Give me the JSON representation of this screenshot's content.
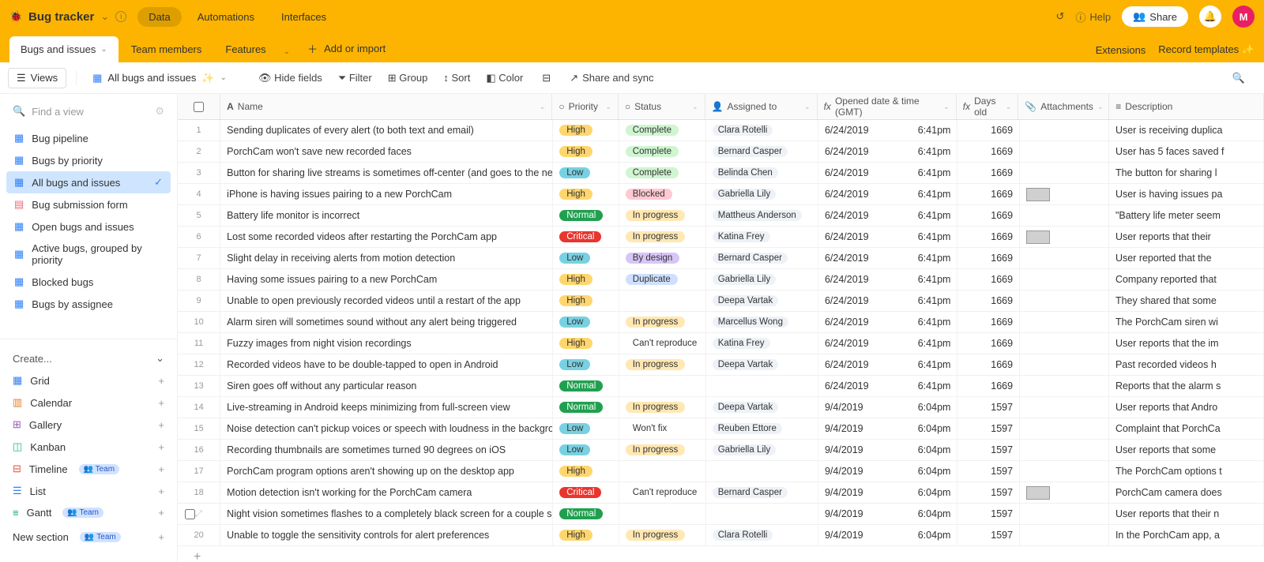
{
  "header": {
    "baseName": "Bug tracker",
    "tabs": [
      "Data",
      "Automations",
      "Interfaces"
    ],
    "activeTab": 0,
    "help": "Help",
    "share": "Share",
    "avatar": "M"
  },
  "tableTabs": {
    "tabs": [
      "Bugs and issues",
      "Team members",
      "Features"
    ],
    "activeTab": 0,
    "addLabel": "Add or import",
    "rightLinks": [
      "Extensions",
      "Record templates"
    ]
  },
  "toolbar": {
    "views": "Views",
    "currentView": "All bugs and issues",
    "items": [
      "Hide fields",
      "Filter",
      "Group",
      "Sort",
      "Color"
    ],
    "shareSync": "Share and sync"
  },
  "sidebar": {
    "searchPlaceholder": "Find a view",
    "views": [
      {
        "icon": "grid",
        "label": "Bug pipeline"
      },
      {
        "icon": "grid",
        "label": "Bugs by priority"
      },
      {
        "icon": "grid",
        "label": "All bugs and issues",
        "active": true
      },
      {
        "icon": "form",
        "label": "Bug submission form"
      },
      {
        "icon": "grid",
        "label": "Open bugs and issues"
      },
      {
        "icon": "grid",
        "label": "Active bugs, grouped by priority"
      },
      {
        "icon": "grid",
        "label": "Blocked bugs"
      },
      {
        "icon": "grid",
        "label": "Bugs by assignee"
      }
    ],
    "createLabel": "Create...",
    "createItems": [
      {
        "icon": "grid",
        "label": "Grid",
        "color": "#2d7ff9"
      },
      {
        "icon": "calendar",
        "label": "Calendar",
        "color": "#e67e22"
      },
      {
        "icon": "gallery",
        "label": "Gallery",
        "color": "#9b59b6"
      },
      {
        "icon": "kanban",
        "label": "Kanban",
        "color": "#1abc9c"
      },
      {
        "icon": "timeline",
        "label": "Timeline",
        "color": "#e74c3c",
        "badge": "Team"
      },
      {
        "icon": "list",
        "label": "List",
        "color": "#2d7ff9"
      },
      {
        "icon": "gantt",
        "label": "Gantt",
        "color": "#16a085",
        "badge": "Team"
      }
    ],
    "newSection": {
      "label": "New section",
      "badge": "Team"
    }
  },
  "columns": [
    {
      "key": "name",
      "label": "Name",
      "icon": "A"
    },
    {
      "key": "priority",
      "label": "Priority",
      "icon": "○"
    },
    {
      "key": "status",
      "label": "Status",
      "icon": "○"
    },
    {
      "key": "assigned",
      "label": "Assigned to",
      "icon": "👤"
    },
    {
      "key": "opened",
      "label": "Opened date & time (GMT)",
      "icon": "fx"
    },
    {
      "key": "days",
      "label": "Days old",
      "icon": "fx"
    },
    {
      "key": "attachments",
      "label": "Attachments",
      "icon": "📎"
    },
    {
      "key": "description",
      "label": "Description",
      "icon": "≡"
    }
  ],
  "rows": [
    {
      "n": 1,
      "name": "Sending duplicates of every alert (to both text and email)",
      "priority": "High",
      "status": "Complete",
      "assigned": "Clara Rotelli",
      "date": "6/24/2019",
      "time": "6:41pm",
      "days": 1669,
      "desc": "User is receiving duplica"
    },
    {
      "n": 2,
      "name": "PorchCam won't save new recorded faces",
      "priority": "High",
      "status": "Complete",
      "assigned": "Bernard Casper",
      "date": "6/24/2019",
      "time": "6:41pm",
      "days": 1669,
      "desc": "User has 5 faces saved f"
    },
    {
      "n": 3,
      "name": "Button for sharing live streams is sometimes off-center (and goes to the next row)",
      "priority": "Low",
      "status": "Complete",
      "assigned": "Belinda Chen",
      "date": "6/24/2019",
      "time": "6:41pm",
      "days": 1669,
      "desc": "The button for sharing l"
    },
    {
      "n": 4,
      "name": "iPhone is having issues pairing to a new PorchCam",
      "priority": "High",
      "status": "Blocked",
      "assigned": "Gabriella Lily",
      "date": "6/24/2019",
      "time": "6:41pm",
      "days": 1669,
      "att": true,
      "desc": "User is having issues pa"
    },
    {
      "n": 5,
      "name": "Battery life monitor is incorrect",
      "priority": "Normal",
      "status": "In progress",
      "assigned": "Mattheus Anderson",
      "date": "6/24/2019",
      "time": "6:41pm",
      "days": 1669,
      "desc": "\"Battery life meter seem"
    },
    {
      "n": 6,
      "name": "Lost some recorded videos after restarting the PorchCam app",
      "priority": "Critical",
      "status": "In progress",
      "assigned": "Katina Frey",
      "date": "6/24/2019",
      "time": "6:41pm",
      "days": 1669,
      "att": true,
      "desc": "User reports that their"
    },
    {
      "n": 7,
      "name": "Slight delay in receiving alerts from motion detection",
      "priority": "Low",
      "status": "By design",
      "assigned": "Bernard Casper",
      "date": "6/24/2019",
      "time": "6:41pm",
      "days": 1669,
      "desc": "User reported that the"
    },
    {
      "n": 8,
      "name": "Having some issues pairing to a new PorchCam",
      "priority": "High",
      "status": "Duplicate",
      "assigned": "Gabriella Lily",
      "date": "6/24/2019",
      "time": "6:41pm",
      "days": 1669,
      "desc": "Company reported that"
    },
    {
      "n": 9,
      "name": "Unable to open previously recorded videos until a restart of the app",
      "priority": "High",
      "status": "",
      "assigned": "Deepa Vartak",
      "date": "6/24/2019",
      "time": "6:41pm",
      "days": 1669,
      "desc": "They shared that some"
    },
    {
      "n": 10,
      "name": "Alarm siren will sometimes sound without any alert being triggered",
      "priority": "Low",
      "status": "In progress",
      "assigned": "Marcellus Wong",
      "date": "6/24/2019",
      "time": "6:41pm",
      "days": 1669,
      "desc": "The PorchCam siren wi"
    },
    {
      "n": 11,
      "name": "Fuzzy images from night vision recordings",
      "priority": "High",
      "status": "Can't reproduce",
      "assigned": "Katina Frey",
      "date": "6/24/2019",
      "time": "6:41pm",
      "days": 1669,
      "desc": "User reports that the im"
    },
    {
      "n": 12,
      "name": "Recorded videos have to be double-tapped to open in Android",
      "priority": "Low",
      "status": "In progress",
      "assigned": "Deepa Vartak",
      "date": "6/24/2019",
      "time": "6:41pm",
      "days": 1669,
      "desc": "Past recorded videos h"
    },
    {
      "n": 13,
      "name": "Siren goes off without any particular reason",
      "priority": "Normal",
      "status": "",
      "assigned": "",
      "date": "6/24/2019",
      "time": "6:41pm",
      "days": 1669,
      "desc": "Reports that the alarm s"
    },
    {
      "n": 14,
      "name": "Live-streaming in Android keeps minimizing from full-screen view",
      "priority": "Normal",
      "status": "In progress",
      "assigned": "Deepa Vartak",
      "date": "9/4/2019",
      "time": "6:04pm",
      "days": 1597,
      "desc": "User reports that Andro"
    },
    {
      "n": 15,
      "name": "Noise detection can't pickup voices or speech with loudness in the background",
      "priority": "Low",
      "status": "Won't fix",
      "assigned": "Reuben Ettore",
      "date": "9/4/2019",
      "time": "6:04pm",
      "days": 1597,
      "desc": "Complaint that PorchCa"
    },
    {
      "n": 16,
      "name": "Recording thumbnails are sometimes turned 90 degrees on iOS",
      "priority": "Low",
      "status": "In progress",
      "assigned": "Gabriella Lily",
      "date": "9/4/2019",
      "time": "6:04pm",
      "days": 1597,
      "desc": "User reports that some"
    },
    {
      "n": 17,
      "name": "PorchCam program options aren't showing up on the desktop app",
      "priority": "High",
      "status": "",
      "assigned": "",
      "date": "9/4/2019",
      "time": "6:04pm",
      "days": 1597,
      "desc": "The PorchCam options t"
    },
    {
      "n": 18,
      "name": "Motion detection isn't working for the PorchCam camera",
      "priority": "Critical",
      "status": "Can't reproduce",
      "assigned": "Bernard Casper",
      "date": "9/4/2019",
      "time": "6:04pm",
      "days": 1597,
      "att": true,
      "desc": "PorchCam camera does"
    },
    {
      "n": 19,
      "name": "Night vision sometimes flashes to a completely black screen for a couple seconds",
      "priority": "Normal",
      "status": "",
      "assigned": "",
      "date": "9/4/2019",
      "time": "6:04pm",
      "days": 1597,
      "expand": true,
      "desc": "User reports that their n"
    },
    {
      "n": 20,
      "name": "Unable to toggle the sensitivity controls for alert preferences",
      "priority": "High",
      "status": "In progress",
      "assigned": "Clara Rotelli",
      "date": "9/4/2019",
      "time": "6:04pm",
      "days": 1597,
      "desc": "In the PorchCam app, a"
    }
  ]
}
